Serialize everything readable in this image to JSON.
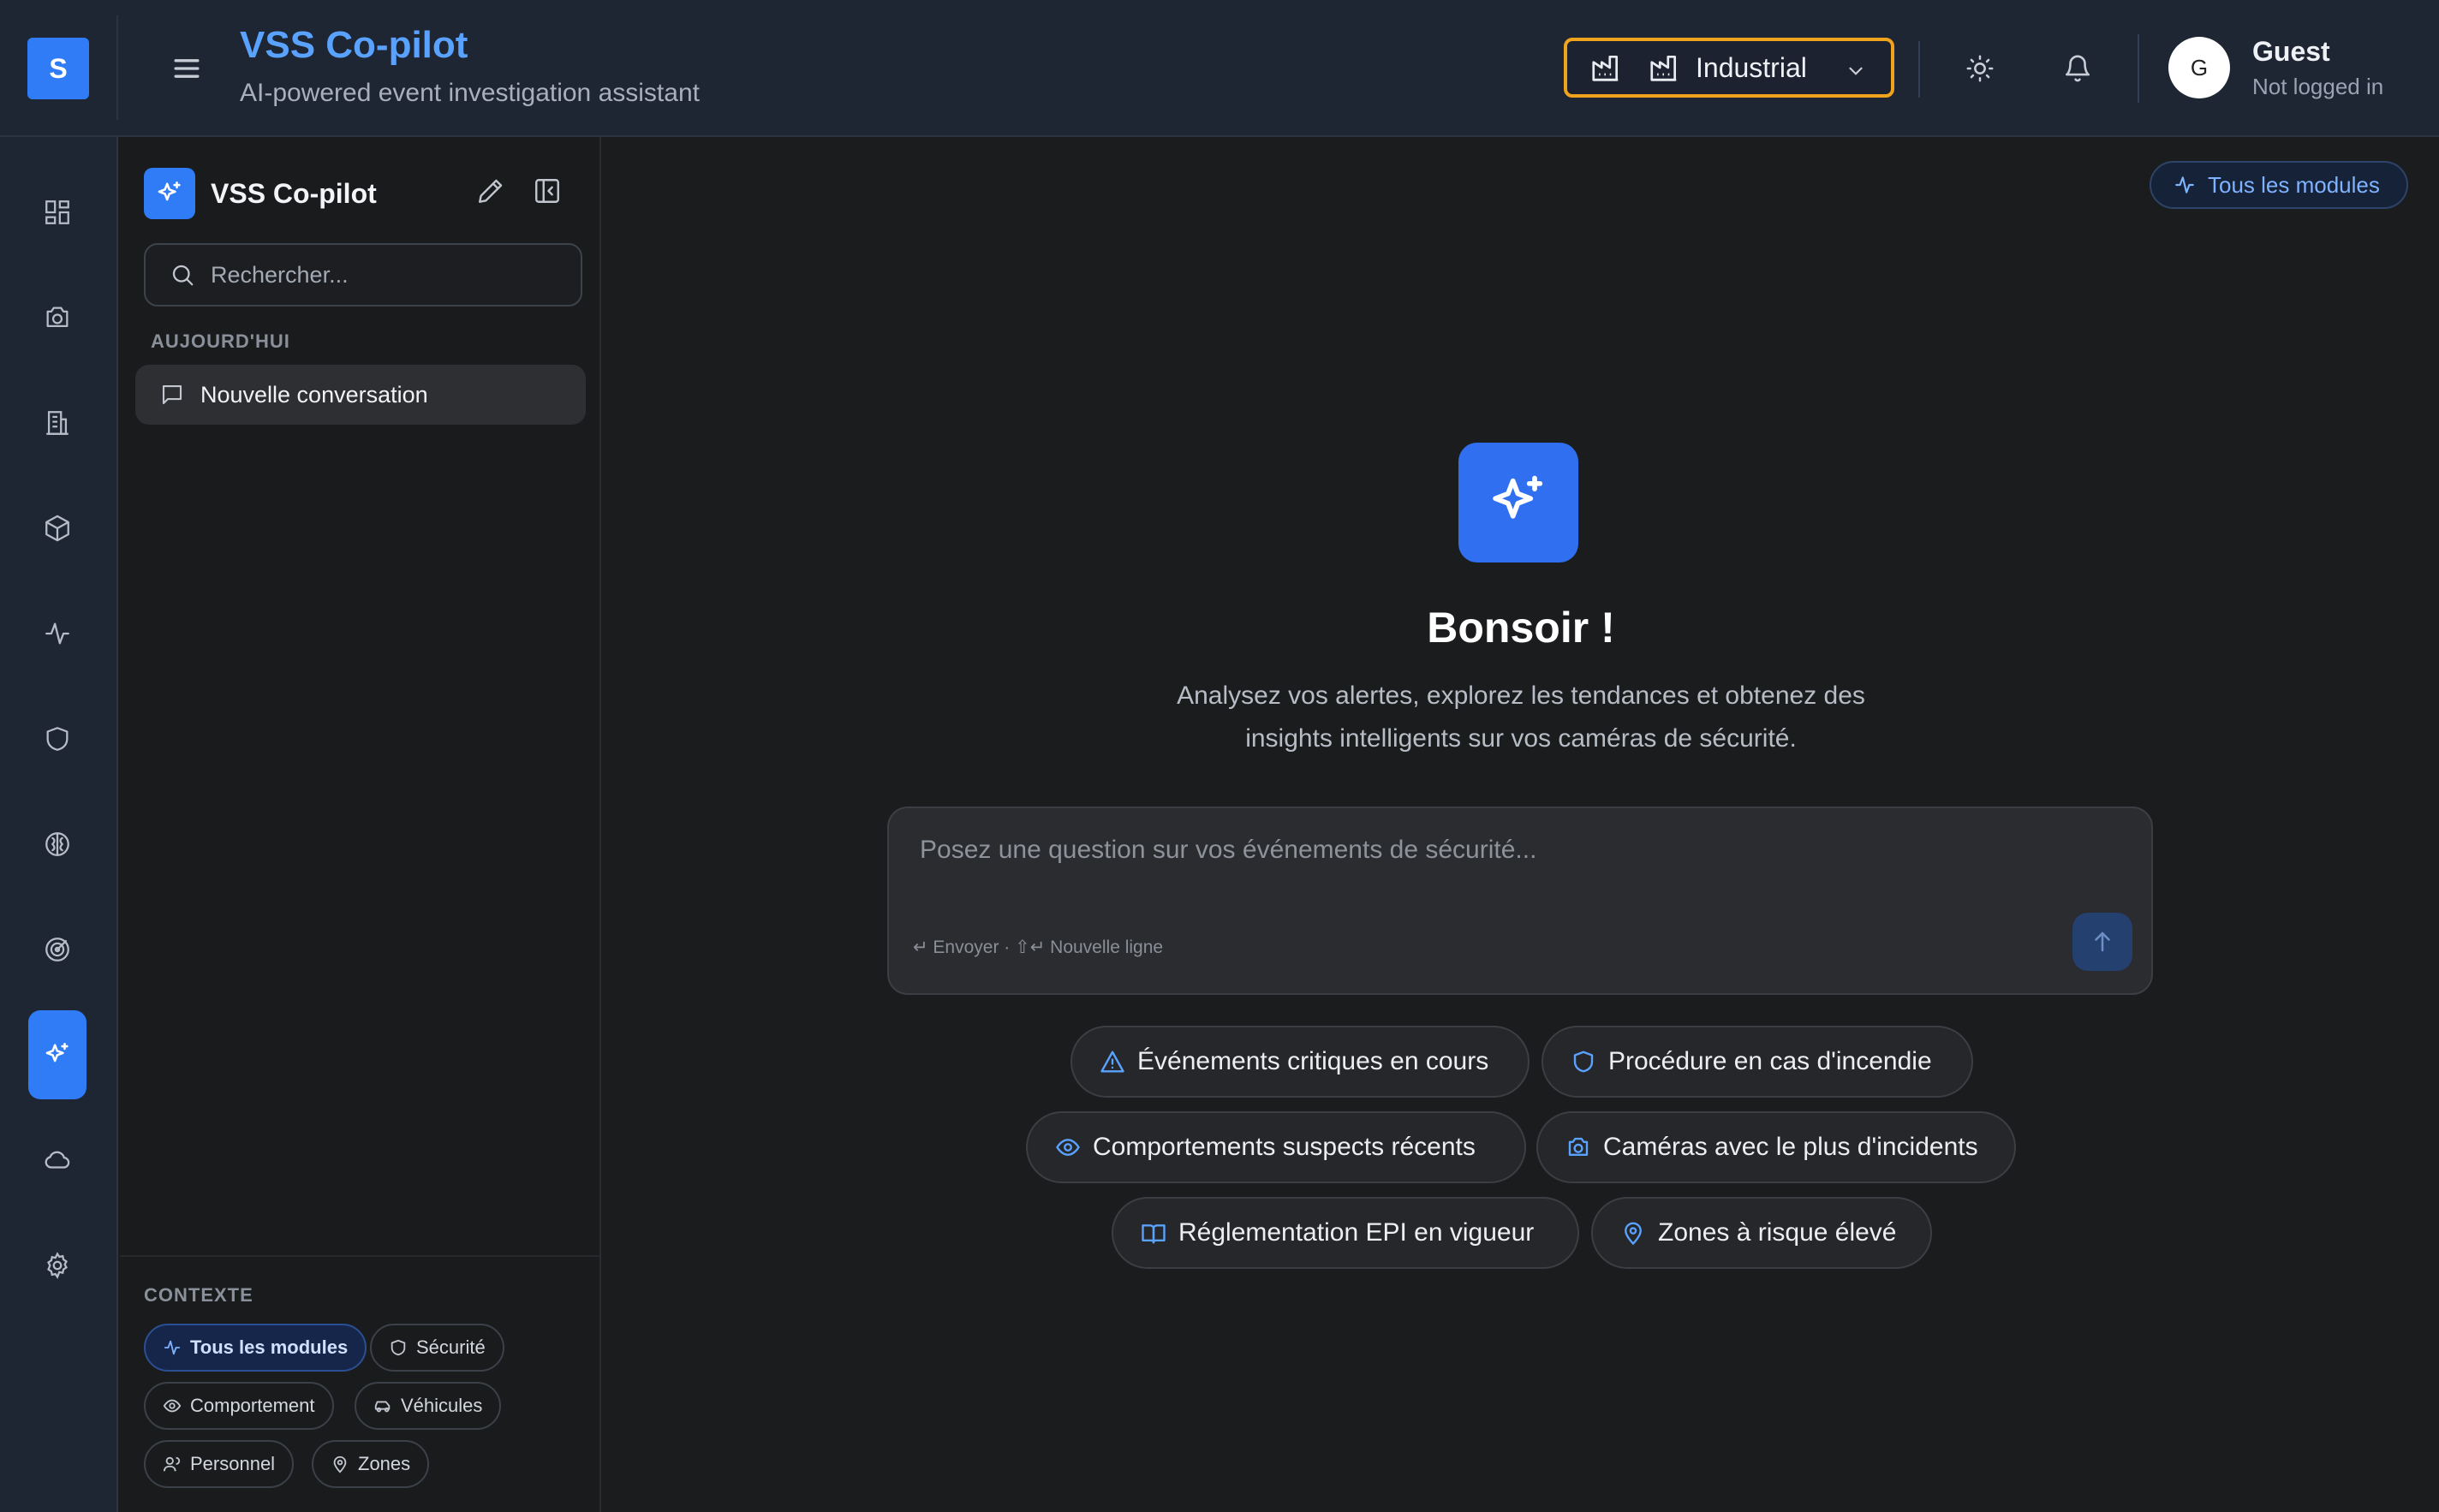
{
  "header": {
    "logo_letter": "S",
    "title": "VSS Co-pilot",
    "subtitle": "AI-powered event investigation assistant",
    "industry_label": "Industrial",
    "user_initial": "G",
    "user_name": "Guest",
    "user_status": "Not logged in"
  },
  "rail": {
    "items": [
      {
        "icon": "dashboard-icon"
      },
      {
        "icon": "camera-icon"
      },
      {
        "icon": "building-icon"
      },
      {
        "icon": "box-icon"
      },
      {
        "icon": "activity-icon"
      },
      {
        "icon": "shield-icon"
      },
      {
        "icon": "brain-icon"
      },
      {
        "icon": "radar-icon"
      },
      {
        "icon": "sparkles-icon",
        "active": true
      },
      {
        "icon": "cloud-icon"
      },
      {
        "icon": "settings-icon"
      }
    ]
  },
  "sidebar": {
    "title": "VSS Co-pilot",
    "search_placeholder": "Rechercher...",
    "section_today": "AUJOURD'HUI",
    "conversations": [
      "Nouvelle conversation"
    ],
    "context_title": "CONTEXTE",
    "context_chips": [
      {
        "label": "Tous les modules",
        "icon": "activity-icon",
        "active": true
      },
      {
        "label": "Sécurité",
        "icon": "shield-icon"
      },
      {
        "label": "Comportement",
        "icon": "eye-icon"
      },
      {
        "label": "Véhicules",
        "icon": "car-icon"
      },
      {
        "label": "Personnel",
        "icon": "users-icon"
      },
      {
        "label": "Zones",
        "icon": "map-pin-icon"
      }
    ]
  },
  "main": {
    "module_pill": "Tous les modules",
    "greeting": "Bonsoir !",
    "intro_line1": "Analysez vos alertes, explorez les tendances et obtenez des",
    "intro_line2": "insights intelligents sur vos caméras de sécurité.",
    "composer_placeholder": "Posez une question sur vos événements de sécurité...",
    "composer_hint": "↵ Envoyer · ⇧↵ Nouvelle ligne",
    "suggestions": [
      {
        "label": "Événements critiques en cours",
        "icon": "alert-triangle-icon"
      },
      {
        "label": "Procédure en cas d'incendie",
        "icon": "shield-icon"
      },
      {
        "label": "Comportements suspects récents",
        "icon": "eye-icon"
      },
      {
        "label": "Caméras avec le plus d'incidents",
        "icon": "camera-icon"
      },
      {
        "label": "Réglementation EPI en vigueur",
        "icon": "book-icon"
      },
      {
        "label": "Zones à risque élevé",
        "icon": "map-pin-icon"
      }
    ]
  },
  "colors": {
    "accent": "#2f7cf6",
    "header_bg": "#1e2533",
    "highlight_border": "#f0a31c",
    "link_blue": "#5aa2ff"
  }
}
